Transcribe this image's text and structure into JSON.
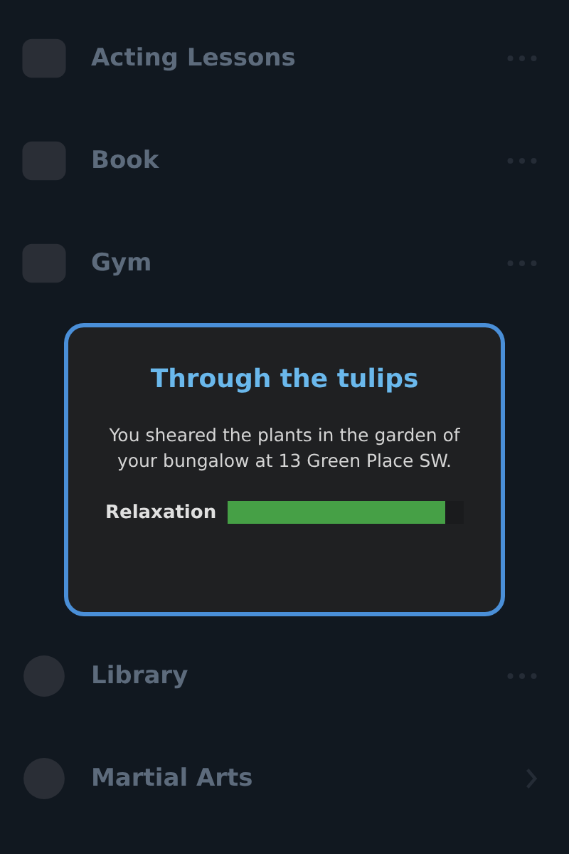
{
  "activities_above": [
    {
      "name": "Acting Lessons",
      "kind": "more"
    },
    {
      "name": "Book",
      "kind": "more"
    },
    {
      "name": "Gym",
      "kind": "more"
    }
  ],
  "dialog": {
    "title": "Through the tulips",
    "message": "You sheared the plants in the garden of your bungalow at 13 Green Place SW.",
    "meter": {
      "label": "Relaxation",
      "level": 0.92
    }
  },
  "activities_below": [
    {
      "name": "Library",
      "kind": "more"
    },
    {
      "name": "Martial Arts",
      "kind": "chevron"
    }
  ]
}
